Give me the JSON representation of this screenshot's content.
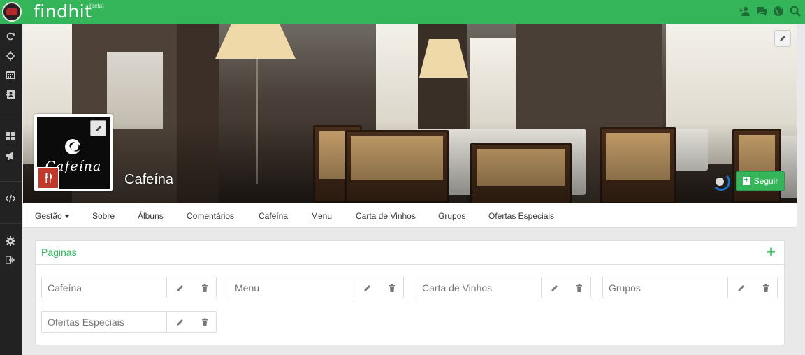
{
  "app": {
    "logo": "findhit",
    "beta": "(beta)"
  },
  "page": {
    "name": "Cafeína",
    "brand_text": "Cafeína",
    "follow_label": "Seguir"
  },
  "tabs": [
    {
      "label": "Gestão"
    },
    {
      "label": "Sobre"
    },
    {
      "label": "Álbuns"
    },
    {
      "label": "Comentários"
    },
    {
      "label": "Cafeína"
    },
    {
      "label": "Menu"
    },
    {
      "label": "Carta de Vinhos"
    },
    {
      "label": "Grupos"
    },
    {
      "label": "Ofertas Especiais"
    }
  ],
  "panel": {
    "title": "Páginas",
    "add_label": "+",
    "pages": [
      {
        "value": "Cafeína"
      },
      {
        "value": "Menu"
      },
      {
        "value": "Carta de Vinhos"
      },
      {
        "value": "Grupos"
      },
      {
        "value": "Ofertas Especiais"
      }
    ]
  },
  "colors": {
    "brand_green": "#34b55a",
    "sidebar": "#222222",
    "category_red": "#c0392b"
  },
  "icons": {
    "top": [
      "user-add-icon",
      "chat-icon",
      "globe-icon",
      "search-icon"
    ],
    "sidebar": [
      "refresh-icon",
      "crosshair-icon",
      "calendar-icon",
      "contacts-icon",
      "grid-icon",
      "megaphone-icon",
      "code-icon",
      "settings-icon",
      "logout-icon"
    ]
  }
}
